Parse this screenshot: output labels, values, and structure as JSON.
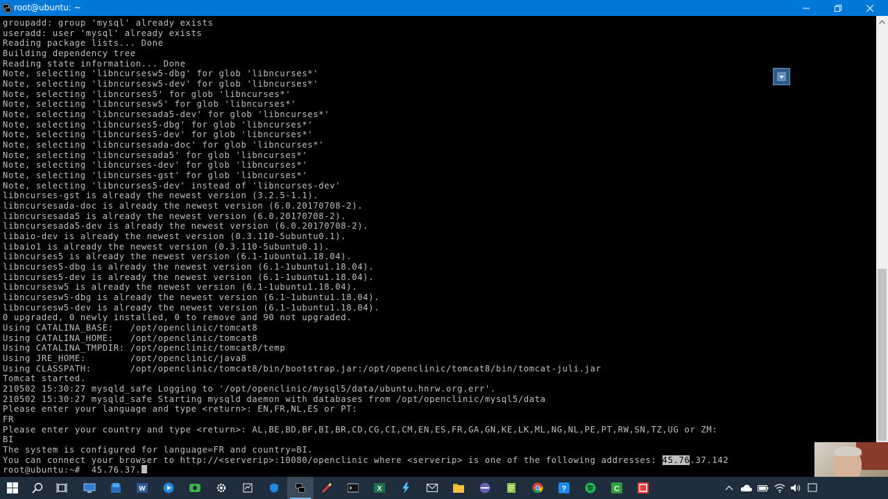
{
  "window": {
    "title": "root@ubuntu: ~",
    "minimize_icon": "minimize-icon",
    "maximize_icon": "restore-icon",
    "close_icon": "close-icon"
  },
  "terminal": {
    "lines": [
      "groupadd: group 'mysql' already exists",
      "useradd: user 'mysql' already exists",
      "Reading package lists... Done",
      "Building dependency tree",
      "Reading state information... Done",
      "Note, selecting 'libncursesw5-dbg' for glob 'libncurses*'",
      "Note, selecting 'libncursesw5-dev' for glob 'libncurses*'",
      "Note, selecting 'libncurses5' for glob 'libncurses*'",
      "Note, selecting 'libncursesw5' for glob 'libncurses*'",
      "Note, selecting 'libncursesada5-dev' for glob 'libncurses*'",
      "Note, selecting 'libncurses5-dbg' for glob 'libncurses*'",
      "Note, selecting 'libncurses5-dev' for glob 'libncurses*'",
      "Note, selecting 'libncursesada-doc' for glob 'libncurses*'",
      "Note, selecting 'libncursesada5' for glob 'libncurses*'",
      "Note, selecting 'libncurses-dev' for glob 'libncurses*'",
      "Note, selecting 'libncurses-gst' for glob 'libncurses*'",
      "Note, selecting 'libncurses5-dev' instead of 'libncurses-dev'",
      "libncurses-gst is already the newest version (3.2.5-1.1).",
      "libncursesada-doc is already the newest version (6.0.20170708-2).",
      "libncursesada5 is already the newest version (6.0.20170708-2).",
      "libncursesada5-dev is already the newest version (6.0.20170708-2).",
      "libaio-dev is already the newest version (0.3.110-5ubuntu0.1).",
      "libaio1 is already the newest version (0.3.110-5ubuntu0.1).",
      "libncurses5 is already the newest version (6.1-1ubuntu1.18.04).",
      "libncurses5-dbg is already the newest version (6.1-1ubuntu1.18.04).",
      "libncurses5-dev is already the newest version (6.1-1ubuntu1.18.04).",
      "libncursesw5 is already the newest version (6.1-1ubuntu1.18.04).",
      "libncursesw5-dbg is already the newest version (6.1-1ubuntu1.18.04).",
      "libncursesw5-dev is already the newest version (6.1-1ubuntu1.18.04).",
      "0 upgraded, 0 newly installed, 0 to remove and 90 not upgraded.",
      "Using CATALINA_BASE:   /opt/openclinic/tomcat8",
      "Using CATALINA_HOME:   /opt/openclinic/tomcat8",
      "Using CATALINA_TMPDIR: /opt/openclinic/tomcat8/temp",
      "Using JRE_HOME:        /opt/openclinic/java8",
      "Using CLASSPATH:       /opt/openclinic/tomcat8/bin/bootstrap.jar:/opt/openclinic/tomcat8/bin/tomcat-juli.jar",
      "Tomcat started.",
      "210502 15:30:27 mysqld_safe Logging to '/opt/openclinic/mysql5/data/ubuntu.hnrw.org.err'.",
      "210502 15:30:27 mysqld_safe Starting mysqld daemon with databases from /opt/openclinic/mysql5/data",
      "Please enter your language and type <return>: EN,FR,NL,ES or PT:",
      "FR",
      "Please enter your country and type <return>: AL,BE,BD,BF,BI,BR,CD,CG,CI,CM,EN,ES,FR,GA,GN,KE,LK,ML,NG,NL,PE,PT,RW,SN,TZ,UG or ZM:",
      "BI",
      "The system is configured for language=FR and country=BI."
    ],
    "address_line": {
      "before": "You can connect your browser to http://<serverip>:10080/openclinic where <serverip> is one of the following addresses: ",
      "selected": "45.76",
      "after": ".37.142"
    },
    "prompt": {
      "text": "root@ubuntu:~#  45.76.37."
    }
  },
  "taskbar": {
    "icons": [
      "windows-start-icon",
      "search-icon",
      "task-view-icon",
      "remote-desktop-icon",
      "app-icon",
      "word-icon",
      "media-player-icon",
      "camtasia-icon",
      "settings-icon",
      "network-icon",
      "vpn-icon",
      "putty-icon",
      "pen-tool-icon",
      "terminal-icon",
      "excel-icon",
      "lightning-app-icon",
      "mail-icon",
      "file-explorer-icon",
      "disc-icon",
      "notepad-icon",
      "chrome-icon",
      "help-icon",
      "spotify-icon",
      "green-app-icon",
      "red-app-icon"
    ],
    "tray_icons": [
      "chevron-up-icon",
      "onedrive-icon",
      "battery-icon",
      "wifi-icon",
      "volume-icon",
      "notification-icon"
    ]
  },
  "colors": {
    "titlebar": "#0078d7",
    "terminal_bg": "#000000",
    "terminal_fg": "#c0c0c0",
    "taskbar": "#1f2d3d"
  }
}
